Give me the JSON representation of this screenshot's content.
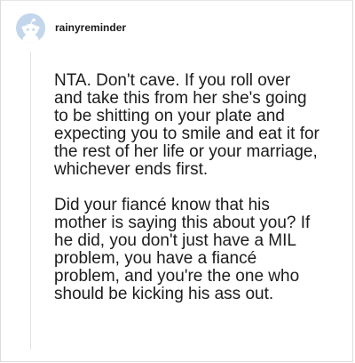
{
  "post": {
    "username": "rainyreminder",
    "avatar_icon": "reddit-snoo-avatar-icon",
    "paragraphs": [
      "NTA. Don't cave. If you roll over and take this from her she's going to be shitting on your plate and expecting you to smile and eat it for the rest of her life or your marriage, whichever ends first.",
      "Did your fiancé know that his mother is saying this about you? If he did, you don't just have a MIL problem, you have a fiancé problem, and you're the one who should be kicking his ass out."
    ]
  },
  "colors": {
    "avatar_bg": "#c3d6ec",
    "text": "#1c1c1c",
    "thread_line": "#e2e2e2"
  }
}
